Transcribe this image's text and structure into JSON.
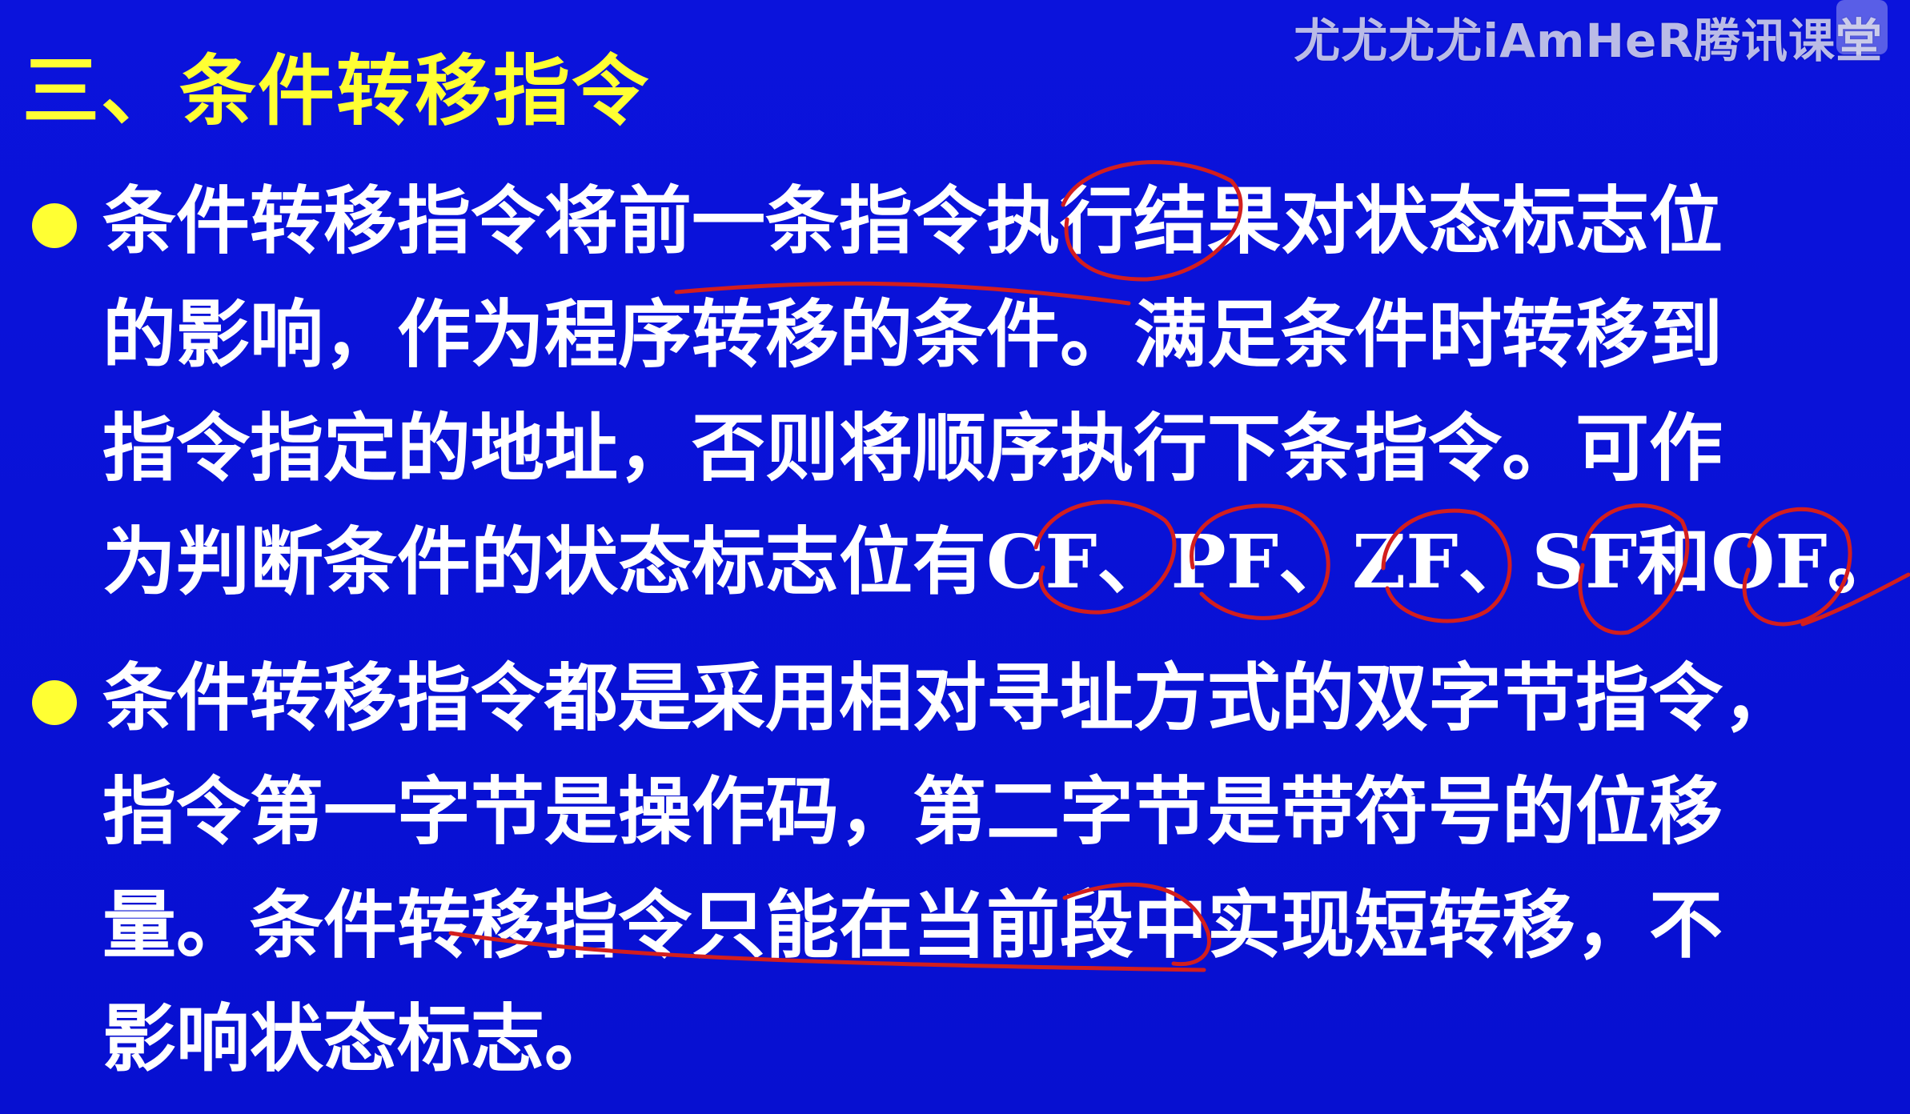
{
  "watermark": "尤尤尤尤iAmHeR腾讯课堂",
  "title": "三、条件转移指令",
  "bullets": [
    {
      "lines": [
        "条件转移指令将前一条指令执行结果对状态标志位",
        "的影响，作为程序转移的条件。满足条件时转移到",
        "指令指定的地址，否则将顺序执行下条指令。可作",
        "为判断条件的状态标志位有CF、PF、ZF、SF和OF。"
      ]
    },
    {
      "lines": [
        "条件转移指令都是采用相对寻址方式的双字节指令，",
        "指令第一字节是操作码，第二字节是带符号的位移",
        "量。条件转移指令只能在当前段中实现短转移，不",
        "影响状态标志。"
      ]
    }
  ],
  "colors": {
    "background": "#0a10d8",
    "title": "#ffff33",
    "bullet": "#ffff33",
    "text": "#ffffff",
    "annotation": "#d31e1e"
  }
}
